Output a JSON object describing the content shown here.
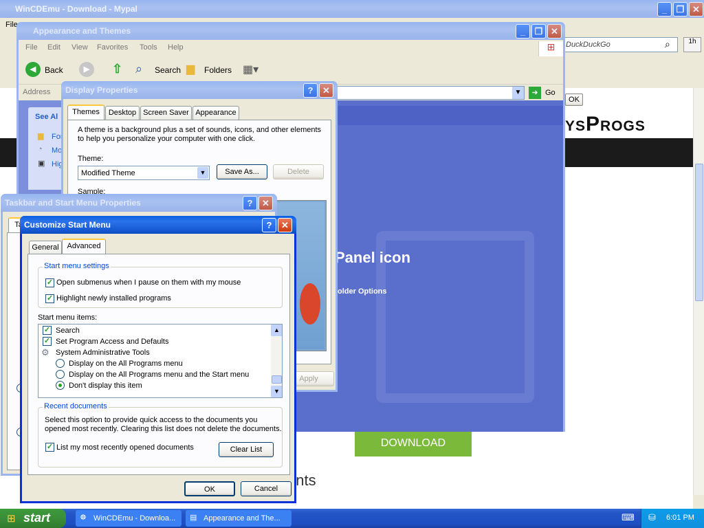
{
  "browser": {
    "title": "WinCDEmu - Download - Mypal",
    "menu_file": "File",
    "search_placeholder": "DuckDuckGo",
    "ok_label": "OK",
    "logo_text": "ysProgs",
    "heading_fragment": "Panel icon",
    "folder_options": "older Options",
    "download_button": "DOWNLOAD",
    "bottom_fragment": "ents",
    "side_badge": "1h"
  },
  "explorer": {
    "title": "Appearance and Themes",
    "menu": [
      "File",
      "Edit",
      "View",
      "Favorites",
      "Tools",
      "Help"
    ],
    "back": "Back",
    "search": "Search",
    "folders": "Folders",
    "address_label": "Address",
    "go": "Go",
    "see_also": "See Al",
    "links": [
      "For",
      "Mo",
      "Hig"
    ]
  },
  "display_props": {
    "title": "Display Properties",
    "tabs": [
      "Themes",
      "Desktop",
      "Screen Saver",
      "Appearance"
    ],
    "description": "A theme is a background plus a set of sounds, icons, and other elements to help you personalize your computer with one click.",
    "theme_label": "Theme:",
    "theme_value": "Modified Theme",
    "save_as": "Save As...",
    "delete": "Delete",
    "sample_label": "Sample:",
    "apply": "Apply"
  },
  "taskbar_props": {
    "title": "Taskbar and Start Menu Properties",
    "tab_fragment": "Ta"
  },
  "customize": {
    "title": "Customize Start Menu",
    "tabs": [
      "General",
      "Advanced"
    ],
    "start_settings_title": "Start menu settings",
    "opt_submenus": "Open submenus when I pause on them with my mouse",
    "opt_highlight": "Highlight newly installed programs",
    "items_label": "Start menu items:",
    "items": {
      "search": "Search",
      "spad": "Set Program Access and Defaults",
      "sat": "System Administrative Tools",
      "r1": "Display on the All Programs menu",
      "r2": "Display on the All Programs menu and the Start menu",
      "r3": "Don't display this item"
    },
    "recent_title": "Recent documents",
    "recent_desc1": "Select this option to provide quick access to the documents you",
    "recent_desc2": "opened most recently.  Clearing this list does not delete the documents.",
    "list_recent": "List my most recently opened documents",
    "clear_list": "Clear List",
    "ok": "OK",
    "cancel": "Cancel"
  },
  "taskbar": {
    "start": "start",
    "tasks": [
      "WinCDEmu - Downloa...",
      "Appearance and The..."
    ],
    "clock": "6:01 PM"
  }
}
